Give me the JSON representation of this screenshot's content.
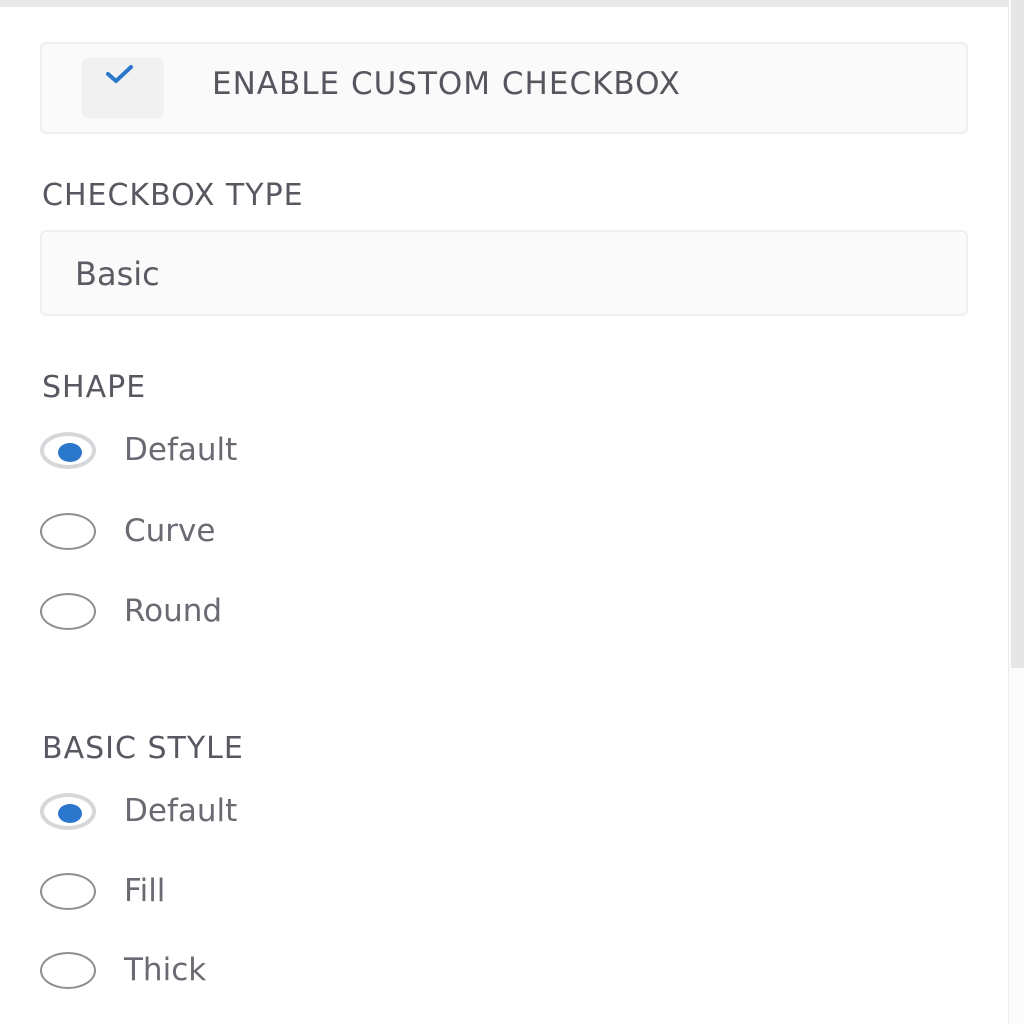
{
  "enable_custom_checkbox": {
    "label": "ENABLE CUSTOM CHECKBOX",
    "checked": true
  },
  "checkbox_type": {
    "label": "CHECKBOX TYPE",
    "value": "Basic"
  },
  "shape": {
    "label": "SHAPE",
    "options": [
      {
        "label": "Default",
        "selected": true
      },
      {
        "label": "Curve",
        "selected": false
      },
      {
        "label": "Round",
        "selected": false
      }
    ]
  },
  "basic_style": {
    "label": "BASIC STYLE",
    "options": [
      {
        "label": "Default",
        "selected": true
      },
      {
        "label": "Fill",
        "selected": false
      },
      {
        "label": "Thick",
        "selected": false
      }
    ]
  },
  "colors": {
    "accent": "#2b77cc"
  }
}
